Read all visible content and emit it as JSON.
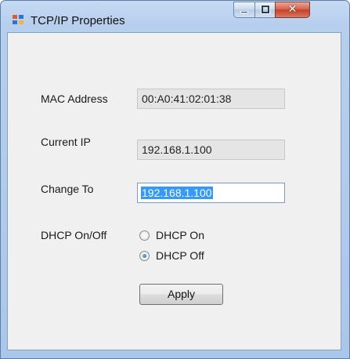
{
  "window": {
    "title": "TCP/IP Properties",
    "caption_buttons": {
      "minimize": "minimize-icon",
      "maximize": "maximize-icon",
      "close": "close-icon"
    },
    "app_icon": "network-app-icon"
  },
  "form": {
    "mac_label": "MAC Address",
    "mac_value": "00:A0:41:02:01:38",
    "current_ip_label": "Current IP",
    "current_ip_value": "192.168.1.100",
    "change_to_label": "Change To",
    "change_to_value": "192.168.1.100",
    "dhcp_label": "DHCP On/Off",
    "dhcp_options": [
      {
        "label": "DHCP On",
        "checked": false
      },
      {
        "label": "DHCP Off",
        "checked": true
      }
    ],
    "apply_label": "Apply"
  },
  "colors": {
    "title_bar": "#b7cfee",
    "client_bg": "#f0f0f0",
    "selection": "#3399ff",
    "close_button": "#c4412a"
  }
}
